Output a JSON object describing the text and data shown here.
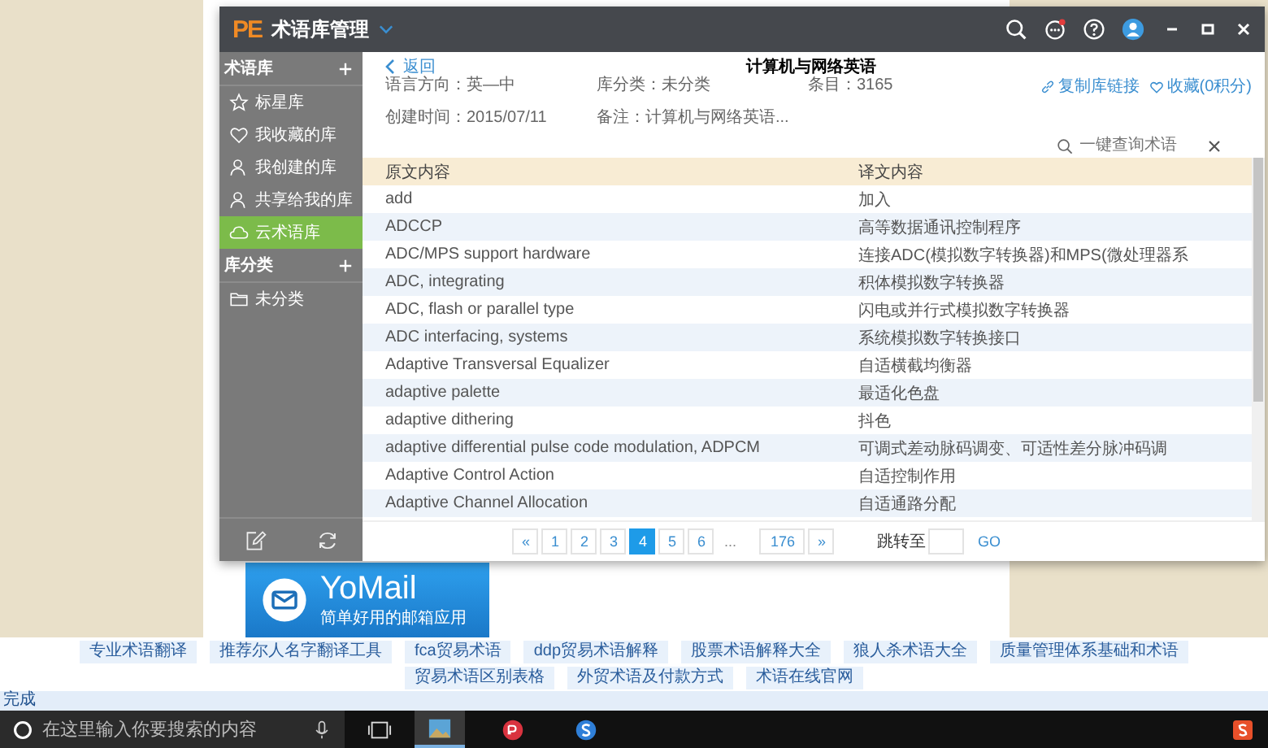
{
  "app": {
    "logo": "PE",
    "title": "术语库管理"
  },
  "sidebar": [
    {
      "title": "术语库",
      "items": [
        {
          "label": "标星库",
          "selected": false
        },
        {
          "label": "我收藏的库",
          "selected": false
        },
        {
          "label": "我创建的库",
          "selected": false
        },
        {
          "label": "共享给我的库",
          "selected": false
        },
        {
          "label": "云术语库",
          "selected": true
        }
      ]
    },
    {
      "title": "库分类",
      "items": [
        {
          "label": "未分类",
          "selected": false
        }
      ]
    }
  ],
  "detail": {
    "back": "返回",
    "title": "计算机与网络英语",
    "fields": [
      "语言方向：英—中",
      "库分类：未分类",
      "条目：3165",
      "创建时间：2015/07/11",
      "备注：计算机与网络英语..."
    ],
    "copy_link": "复制库链接",
    "favorite": "收藏(0积分)",
    "search": {
      "placeholder": "一键查询术语"
    }
  },
  "table": {
    "columns": [
      "原文内容",
      "译文内容"
    ],
    "rows": [
      [
        "add",
        "加入"
      ],
      [
        "ADCCP",
        "高等数据通讯控制程序"
      ],
      [
        "ADC/MPS support hardware",
        "连接ADC(模拟数字转换器)和MPS(微处理器系"
      ],
      [
        "ADC, integrating",
        "积体模拟数字转换器"
      ],
      [
        "ADC, flash or parallel type",
        "闪电或并行式模拟数字转换器"
      ],
      [
        "ADC interfacing, systems",
        "系统模拟数字转换接口"
      ],
      [
        "Adaptive Transversal Equalizer",
        "自适横截均衡器"
      ],
      [
        "adaptive palette",
        "最适化色盘"
      ],
      [
        "adaptive dithering",
        "抖色"
      ],
      [
        "adaptive differential pulse code modulation, ADPCM",
        "可调式差动脉码调变、可适性差分脉冲码调"
      ],
      [
        "Adaptive Control Action",
        "自适控制作用"
      ],
      [
        "Adaptive Channel Allocation",
        "自适通路分配"
      ]
    ]
  },
  "pagination": {
    "prev": "«",
    "pages": [
      {
        "label": "1",
        "selected": false
      },
      {
        "label": "2",
        "selected": false
      },
      {
        "label": "3",
        "selected": false
      },
      {
        "label": "4",
        "selected": true
      },
      {
        "label": "5",
        "selected": false
      },
      {
        "label": "6",
        "selected": false
      }
    ],
    "ellipsis": "...",
    "last": "176",
    "next": "»",
    "jump_label": "跳转至",
    "go": "GO"
  },
  "ad": {
    "name": "YoMail",
    "tagline": "简单好用的邮箱应用"
  },
  "links": [
    "专业术语翻译",
    "推荐尔人名字翻译工具",
    "fca贸易术语",
    "ddp贸易术语解释",
    "股票术语解释大全",
    "狼人杀术语大全",
    "质量管理体系基础和术语",
    "贸易术语区别表格",
    "外贸术语及付款方式",
    "术语在线官网"
  ],
  "status": "完成",
  "taskbar": {
    "search_placeholder": "在这里输入你要搜索的内容"
  }
}
